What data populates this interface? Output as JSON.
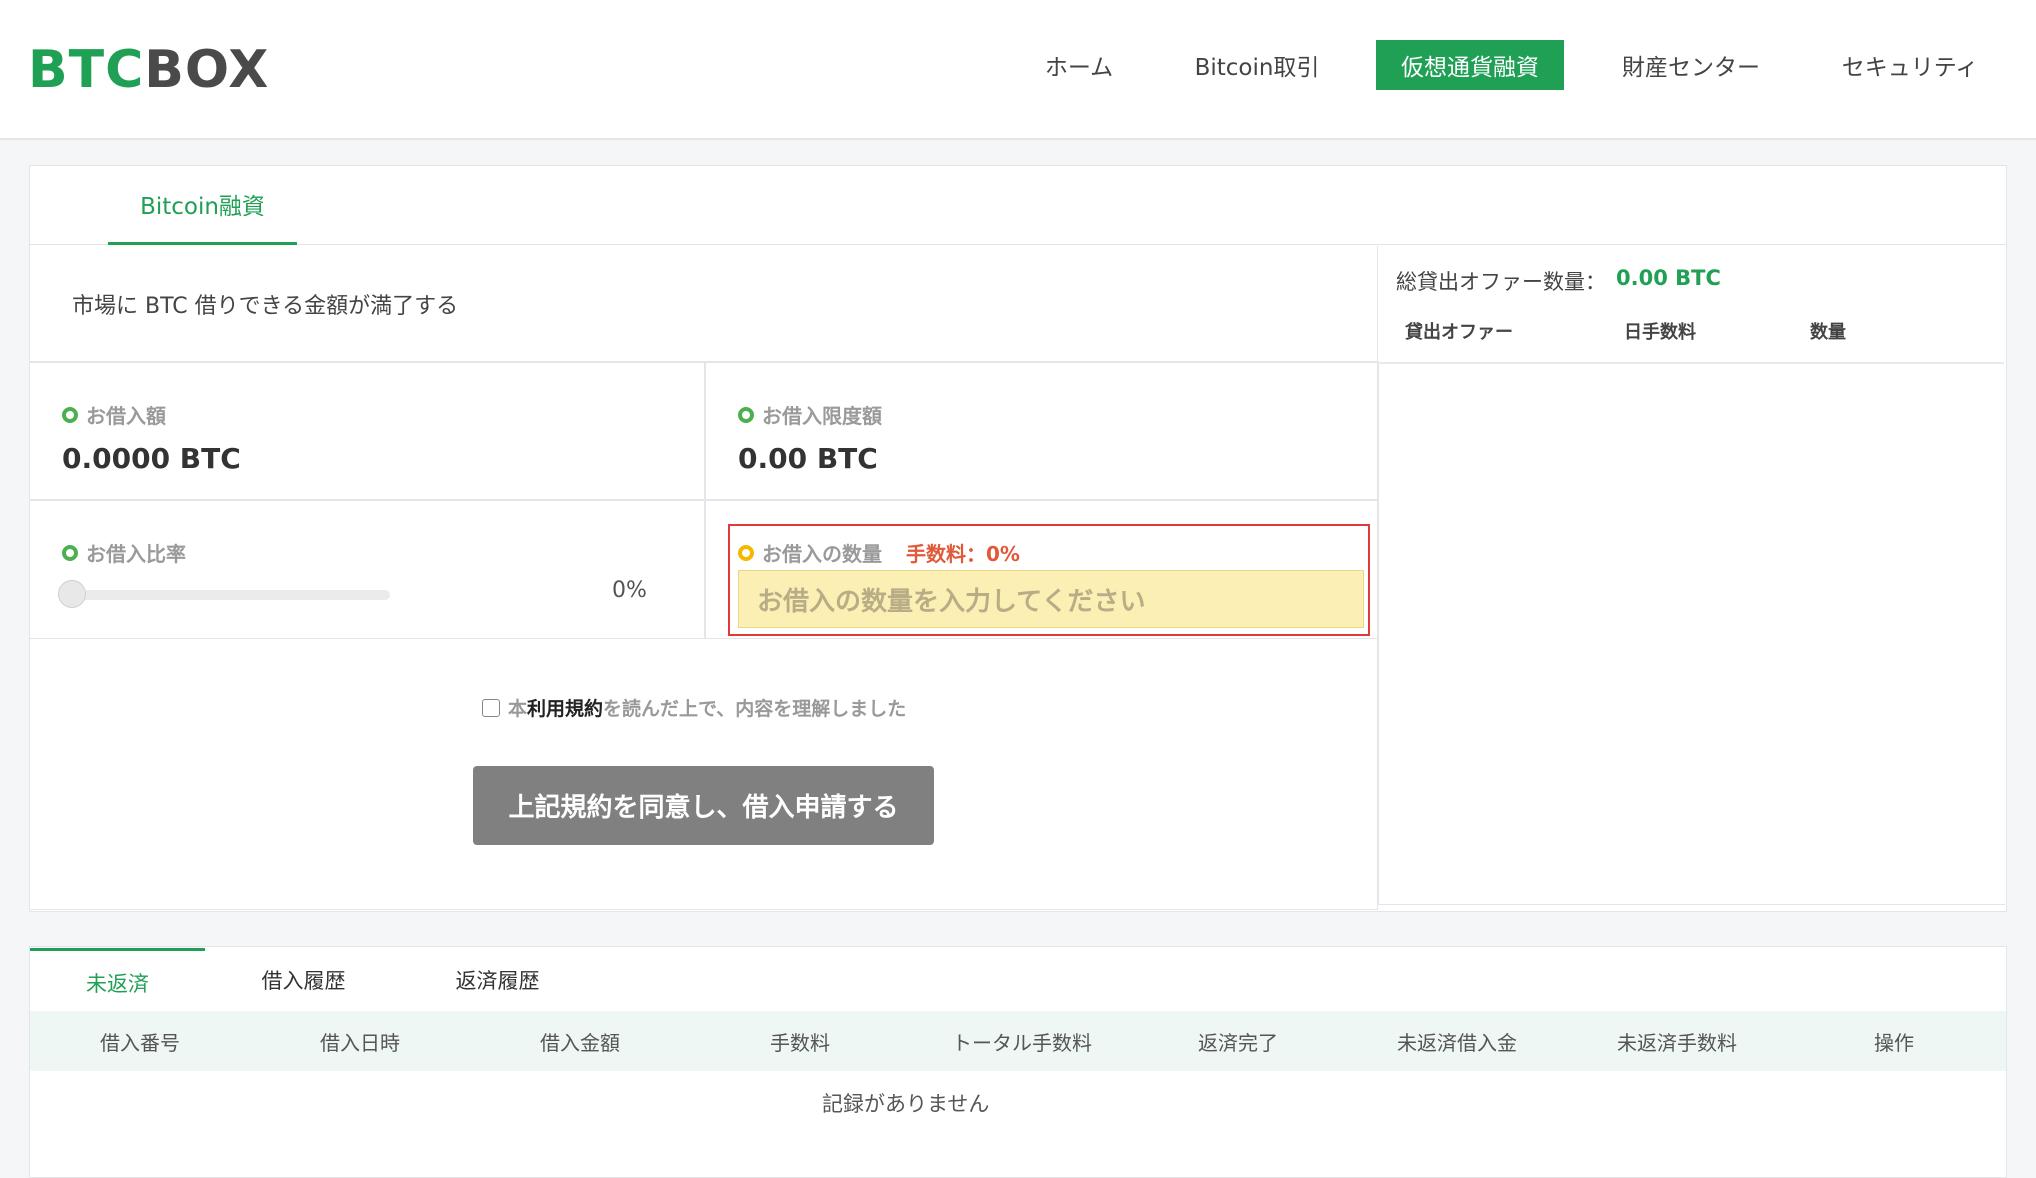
{
  "header": {
    "logo_part1": "BTC",
    "logo_part2": "BOX",
    "nav": [
      "ホーム",
      "Bitcoin取引",
      "仮想通貨融資",
      "財産センター",
      "セキュリティ"
    ]
  },
  "loan_tab": "Bitcoin融資",
  "market_note": "市場に BTC 借りできる金額が満了する",
  "borrow_amount": {
    "label": "お借入額",
    "value": "0.0000  BTC"
  },
  "borrow_limit": {
    "label": "お借入限度額",
    "value": "0.00 BTC"
  },
  "borrow_ratio": {
    "label": "お借入比率",
    "percent_text": "0%",
    "level": 0
  },
  "borrow_qty": {
    "label": "お借入の数量",
    "fee": "手数料：0%",
    "placeholder": "お借入の数量を入力してください"
  },
  "agreement": {
    "prefix": "本",
    "link": "利用規約",
    "suffix": "を読んだ上で、内容を理解しました"
  },
  "submit_label": "上記規約を同意し、借入申請する",
  "sidebar": {
    "total_label": "総貸出オファー数量：",
    "total_value": "0.00 BTC",
    "columns": [
      "貸出オファー",
      "日手数料",
      "数量"
    ]
  },
  "bottom_tabs": [
    "未返済",
    "借入履歴",
    "返済履歴"
  ],
  "table": {
    "columns": [
      "借入番号",
      "借入日時",
      "借入金額",
      "手数料",
      "トータル手数料",
      "返済完了",
      "未返済借入金",
      "未返済手数料",
      "操作"
    ],
    "empty": "記録がありません"
  },
  "colors": {
    "accent": "#1fa055",
    "highlight": "#e03b3b",
    "fee": "#e05a3a"
  }
}
